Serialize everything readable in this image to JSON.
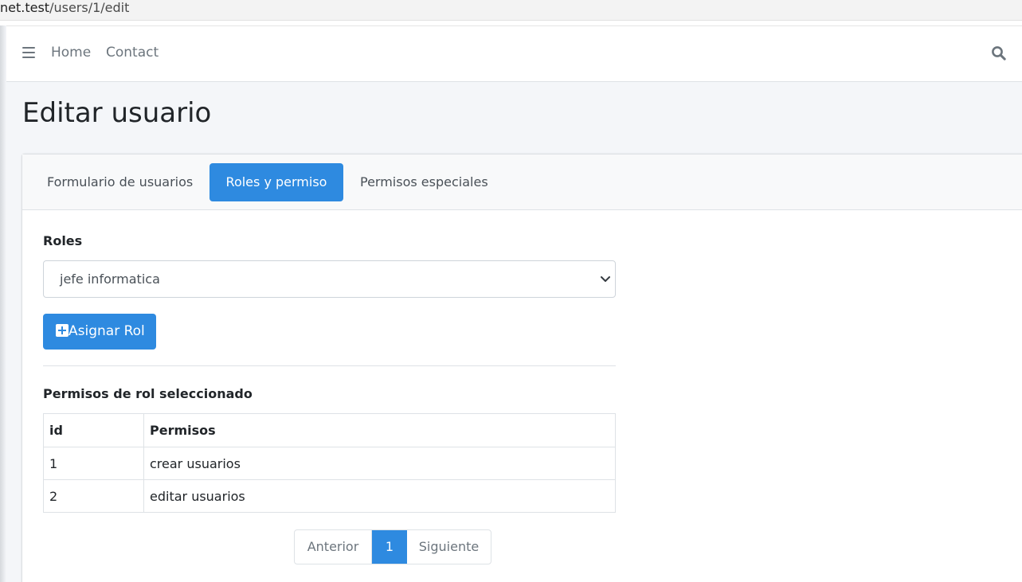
{
  "browser": {
    "url_host": "net.test",
    "url_path": "/users/1/edit"
  },
  "navbar": {
    "home": "Home",
    "contact": "Contact"
  },
  "page": {
    "title": "Editar usuario"
  },
  "tabs": [
    {
      "label": "Formulario de usuarios",
      "active": false
    },
    {
      "label": "Roles y permiso",
      "active": true
    },
    {
      "label": "Permisos especiales",
      "active": false
    }
  ],
  "roles": {
    "label": "Roles",
    "selected": "jefe informatica",
    "assign_button": "Asignar Rol"
  },
  "permissions": {
    "title": "Permisos de rol seleccionado",
    "columns": [
      "id",
      "Permisos"
    ],
    "rows": [
      {
        "id": "1",
        "name": "crear usuarios"
      },
      {
        "id": "2",
        "name": "editar usuarios"
      }
    ]
  },
  "pagination": {
    "prev": "Anterior",
    "current": "1",
    "next": "Siguiente"
  },
  "colors": {
    "primary": "#2e8ae0",
    "muted_text": "#6c757d",
    "background": "#f4f6f9"
  }
}
